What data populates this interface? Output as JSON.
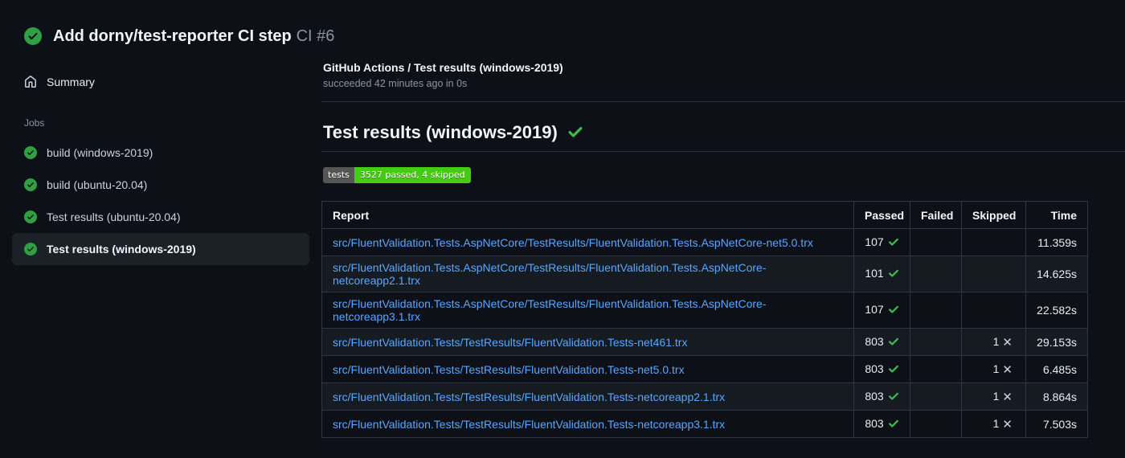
{
  "colors": {
    "background": "#0d1117",
    "status_green": "#2ea043",
    "check_green": "#3fb950",
    "link_blue": "#58a6ff",
    "table_border": "#30363d",
    "row_alt_bg": "#161b22",
    "selected_job_bg": "#1c2128",
    "badge_label_bg": "#555555",
    "badge_value_bg": "#44cc11",
    "text_secondary": "#8b949e"
  },
  "run_header": {
    "title": "Add dorny/test-reporter CI step",
    "run_number": "CI #6",
    "status_icon": "check-circle-icon"
  },
  "sidebar": {
    "summary_label": "Summary",
    "summary_icon": "home-icon",
    "jobs_heading": "Jobs",
    "jobs": [
      {
        "label": "build (windows-2019)",
        "status_icon": "check-circle-icon",
        "selected": false
      },
      {
        "label": "build (ubuntu-20.04)",
        "status_icon": "check-circle-icon",
        "selected": false
      },
      {
        "label": "Test results (ubuntu-20.04)",
        "status_icon": "check-circle-icon",
        "selected": false
      },
      {
        "label": "Test results (windows-2019)",
        "status_icon": "check-circle-icon",
        "selected": true
      }
    ]
  },
  "job_summary": {
    "title": "GitHub Actions / Test results (windows-2019)",
    "status_line": "succeeded 42 minutes ago in 0s"
  },
  "report": {
    "heading": "Test results (windows-2019)",
    "heading_icon": "check-icon",
    "badge": {
      "label": "tests",
      "value": "3527 passed, 4 skipped"
    },
    "table": {
      "columns": [
        "Report",
        "Passed",
        "Failed",
        "Skipped",
        "Time"
      ],
      "passed_icon": "check-icon",
      "skipped_icon": "x-icon",
      "rows": [
        {
          "report": "src/FluentValidation.Tests.AspNetCore/TestResults/FluentValidation.Tests.AspNetCore-net5.0.trx",
          "passed": "107",
          "failed": "",
          "skipped": "",
          "time": "11.359s"
        },
        {
          "report": "src/FluentValidation.Tests.AspNetCore/TestResults/FluentValidation.Tests.AspNetCore-netcoreapp2.1.trx",
          "passed": "101",
          "failed": "",
          "skipped": "",
          "time": "14.625s"
        },
        {
          "report": "src/FluentValidation.Tests.AspNetCore/TestResults/FluentValidation.Tests.AspNetCore-netcoreapp3.1.trx",
          "passed": "107",
          "failed": "",
          "skipped": "",
          "time": "22.582s"
        },
        {
          "report": "src/FluentValidation.Tests/TestResults/FluentValidation.Tests-net461.trx",
          "passed": "803",
          "failed": "",
          "skipped": "1",
          "time": "29.153s"
        },
        {
          "report": "src/FluentValidation.Tests/TestResults/FluentValidation.Tests-net5.0.trx",
          "passed": "803",
          "failed": "",
          "skipped": "1",
          "time": "6.485s"
        },
        {
          "report": "src/FluentValidation.Tests/TestResults/FluentValidation.Tests-netcoreapp2.1.trx",
          "passed": "803",
          "failed": "",
          "skipped": "1",
          "time": "8.864s"
        },
        {
          "report": "src/FluentValidation.Tests/TestResults/FluentValidation.Tests-netcoreapp3.1.trx",
          "passed": "803",
          "failed": "",
          "skipped": "1",
          "time": "7.503s"
        }
      ]
    }
  }
}
